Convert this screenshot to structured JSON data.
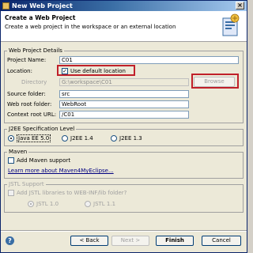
{
  "window": {
    "title": "New Web Project"
  },
  "banner": {
    "heading": "Create a Web Project",
    "description": "Create a web project in the workspace or an external location"
  },
  "details": {
    "group_label": "Web Project Details",
    "project_name_label": "Project Name:",
    "project_name_value": "C01",
    "location_label": "Location:",
    "use_default_label": "Use default location",
    "use_default_checked": true,
    "directory_label": "Directory",
    "directory_value": "G:\\workspace\\C01",
    "browse_label": "Browse",
    "source_folder_label": "Source folder:",
    "source_folder_value": "src",
    "web_root_label": "Web root folder:",
    "web_root_value": "WebRoot",
    "context_root_label": "Context root URL:",
    "context_root_value": "/C01"
  },
  "j2ee": {
    "group_label": "J2EE Specification Level",
    "options": [
      "Java EE 5.0",
      "J2EE 1.4",
      "J2EE 1.3"
    ],
    "selected": "Java EE 5.0"
  },
  "maven": {
    "group_label": "Maven",
    "add_support_label": "Add Maven support",
    "add_support_checked": false,
    "learn_more_label": "Learn more about Maven4MyEclipse..."
  },
  "jstl": {
    "group_label": "JSTL Support",
    "add_libraries_label": "Add JSTL libraries to WEB-INF/lib folder?",
    "add_libraries_checked": false,
    "options": [
      "JSTL 1.0",
      "JSTL 1.1"
    ],
    "selected": "JSTL 1.0"
  },
  "footer": {
    "back_label": "< Back",
    "next_label": "Next >",
    "finish_label": "Finish",
    "cancel_label": "Cancel"
  },
  "colors": {
    "highlight": "#c0202a",
    "title_bar": "#0a246a"
  },
  "icons": [
    "app-icon",
    "close-icon",
    "wizard-icon",
    "help-icon"
  ]
}
